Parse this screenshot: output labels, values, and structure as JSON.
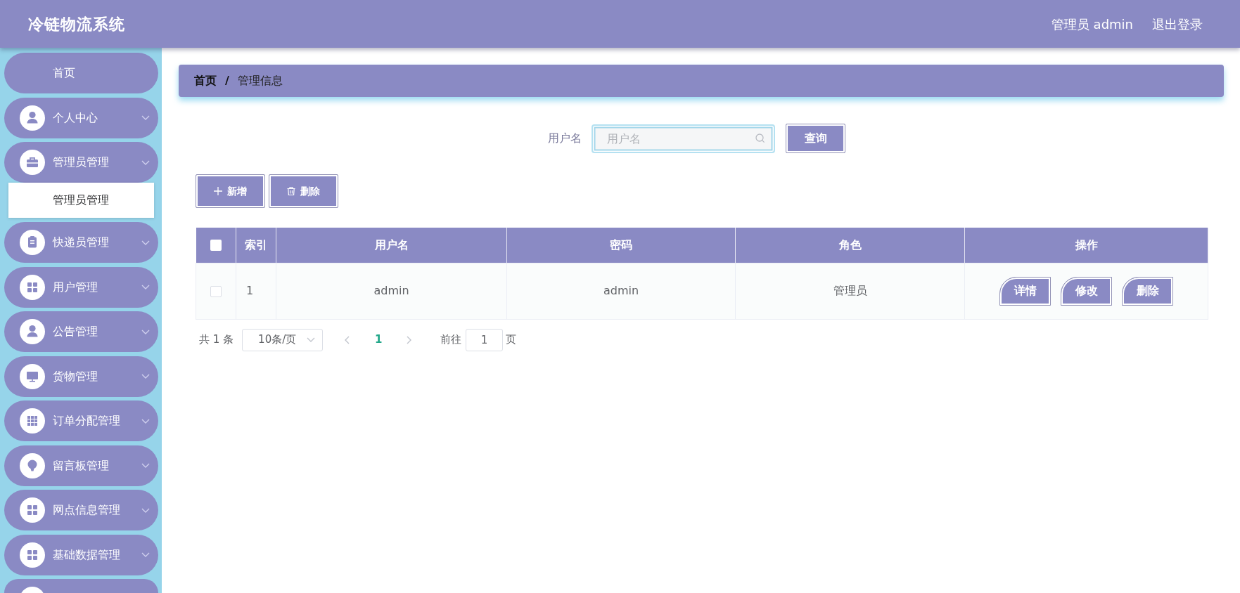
{
  "header": {
    "title": "冷链物流系统",
    "user": "管理员 admin",
    "logout": "退出登录"
  },
  "sidebar": {
    "items": [
      {
        "kind": "link",
        "label": "首页",
        "selected": false
      },
      {
        "kind": "menu",
        "label": "个人中心",
        "selected": false
      },
      {
        "kind": "menu",
        "label": "管理员管理",
        "selected": false,
        "children": [
          {
            "label": "管理员管理",
            "selected": true
          }
        ]
      },
      {
        "kind": "menu",
        "label": "快递员管理",
        "selected": false
      },
      {
        "kind": "menu",
        "label": "用户管理",
        "selected": false
      },
      {
        "kind": "menu",
        "label": "公告管理",
        "selected": false
      },
      {
        "kind": "menu",
        "label": "货物管理",
        "selected": false
      },
      {
        "kind": "menu",
        "label": "订单分配管理",
        "selected": false
      },
      {
        "kind": "menu",
        "label": "留言板管理",
        "selected": false
      },
      {
        "kind": "menu",
        "label": "网点信息管理",
        "selected": false
      },
      {
        "kind": "menu",
        "label": "基础数据管理",
        "selected": false
      },
      {
        "kind": "cut_off",
        "selected": false
      }
    ]
  },
  "breadcrumb": {
    "separator": "/",
    "items": [
      {
        "label": "首页",
        "current": false
      },
      {
        "label": "管理信息",
        "current": true
      }
    ]
  },
  "search": {
    "label": "用户名",
    "placeholder": "用户名",
    "button": "查询"
  },
  "toolbar": [
    {
      "kind": "add",
      "label": "新增"
    },
    {
      "kind": "delete",
      "label": "删除"
    }
  ],
  "table": {
    "select_all": {
      "checked": false
    },
    "columns": [
      "索引",
      "用户名",
      "密码",
      "角色",
      "操作"
    ],
    "rows": [
      {
        "checked": false,
        "cells": [
          "1",
          "admin",
          "admin",
          "管理员"
        ],
        "actions": [
          "详情",
          "修改",
          "删除"
        ]
      }
    ]
  },
  "pagination": {
    "total": "共 1 条",
    "page_size": "10条/页",
    "prev": {
      "disabled": true
    },
    "pages": [
      {
        "label": "1",
        "selected": true
      }
    ],
    "next": {
      "disabled": true
    },
    "goto_label": "前往",
    "goto_value": "1",
    "goto_suffix": "页"
  }
}
